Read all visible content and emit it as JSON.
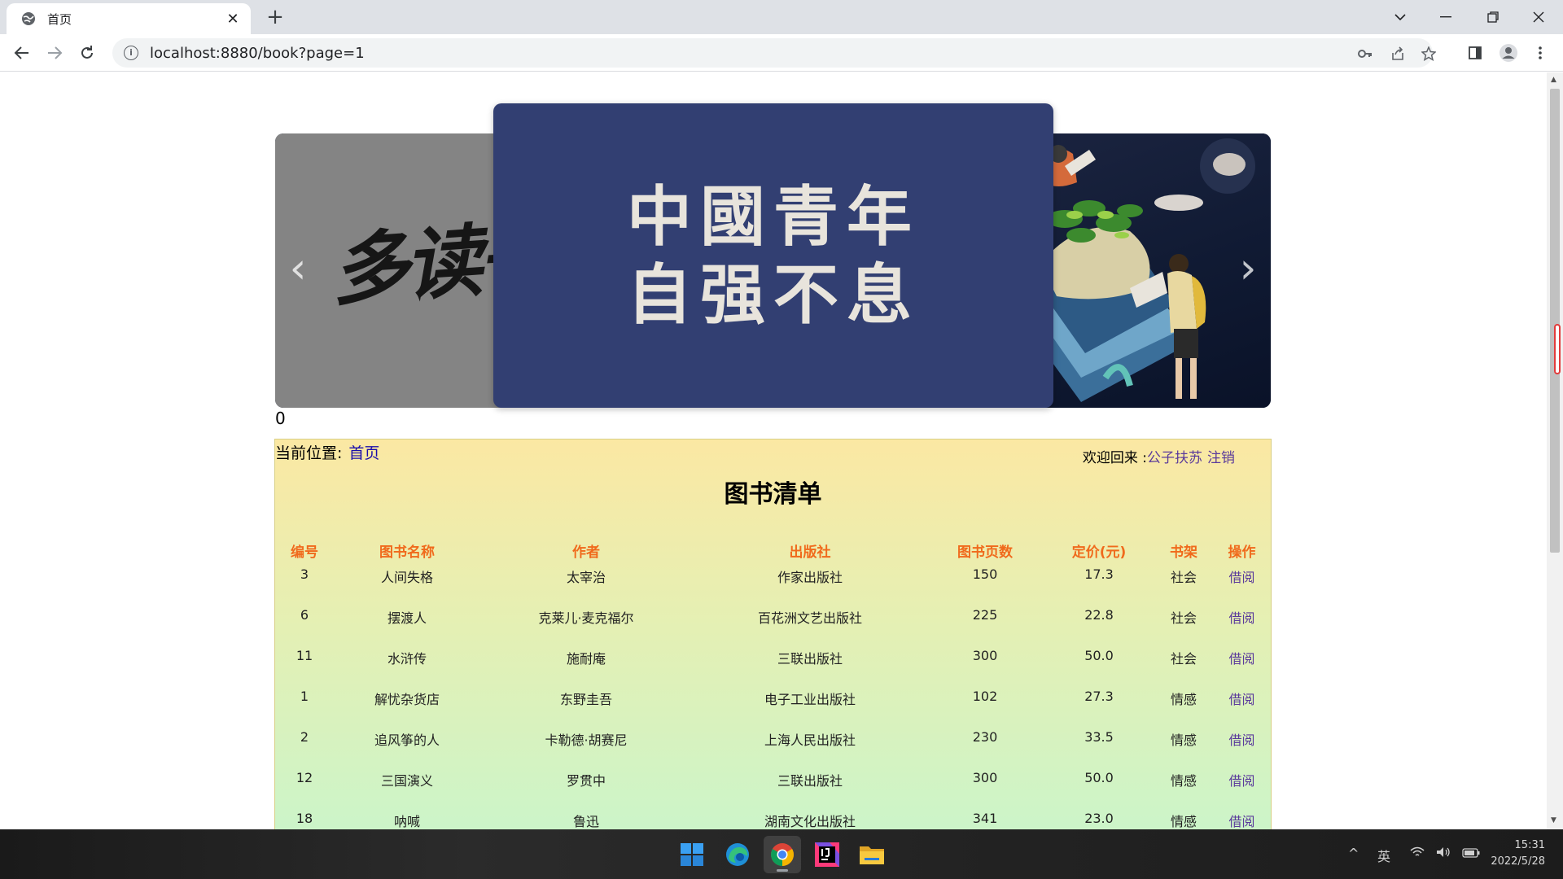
{
  "browser": {
    "tab_title": "首页",
    "tab_close": "✕",
    "new_tab": "+",
    "url": "localhost:8880/book?page=1"
  },
  "carousel": {
    "left_slide_text": "多读书",
    "center_line1": "中國青年",
    "center_line2": "自强不息",
    "prev_arrow": "‹",
    "next_arrow": "›",
    "counter": "0"
  },
  "breadcrumb": {
    "label": "当前位置:",
    "home_link": "首页"
  },
  "welcome": {
    "prefix": "欢迎回来 :",
    "username": "公子扶苏",
    "logout": "注销"
  },
  "book_list": {
    "title": "图书清单",
    "headers": [
      "编号",
      "图书名称",
      "作者",
      "出版社",
      "图书页数",
      "定价(元)",
      "书架",
      "操作"
    ],
    "rows": [
      [
        "3",
        "人间失格",
        "太宰治",
        "作家出版社",
        "150",
        "17.3",
        "社会",
        "借阅"
      ],
      [
        "6",
        "摆渡人",
        "克莱儿·麦克福尔",
        "百花洲文艺出版社",
        "225",
        "22.8",
        "社会",
        "借阅"
      ],
      [
        "11",
        "水浒传",
        "施耐庵",
        "三联出版社",
        "300",
        "50.0",
        "社会",
        "借阅"
      ],
      [
        "1",
        "解忧杂货店",
        "东野圭吾",
        "电子工业出版社",
        "102",
        "27.3",
        "情感",
        "借阅"
      ],
      [
        "2",
        "追风筝的人",
        "卡勒德·胡赛尼",
        "上海人民出版社",
        "230",
        "33.5",
        "情感",
        "借阅"
      ],
      [
        "12",
        "三国演义",
        "罗贯中",
        "三联出版社",
        "300",
        "50.0",
        "情感",
        "借阅"
      ],
      [
        "18",
        "呐喊",
        "鲁迅",
        "湖南文化出版社",
        "341",
        "23.0",
        "情感",
        "借阅"
      ]
    ]
  },
  "taskbar": {
    "tray_ime": "英",
    "time": "15:31",
    "date": "2022/5/28"
  }
}
